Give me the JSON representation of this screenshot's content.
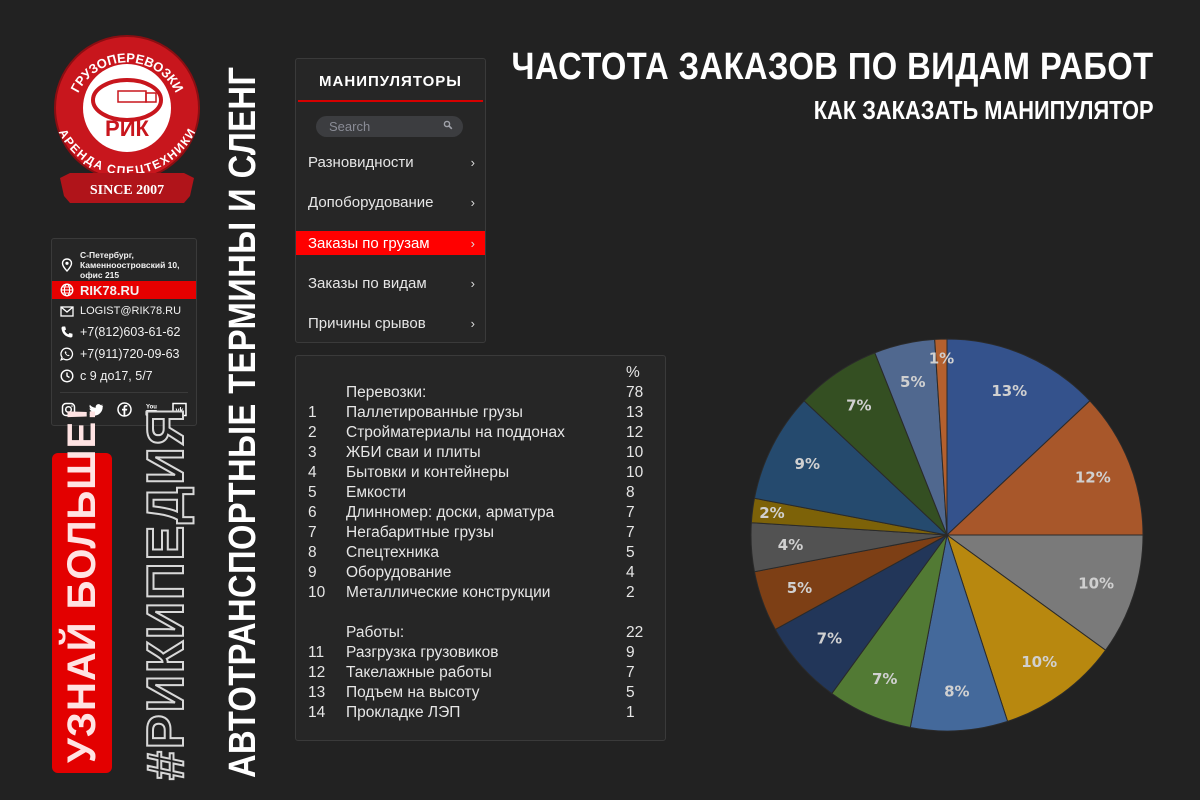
{
  "logo": {
    "top_text": "ГРУЗОПЕРЕВОЗКИ",
    "bottom_text": "АРЕНДА СПЕЦТЕХНИКИ",
    "brand": "РИК",
    "ribbon": "SINCE 2007",
    "color": "#d71920"
  },
  "contacts": {
    "address_line1": "С-Петербург,",
    "address_line2": "Каменноостровский 10,",
    "address_line3": "офис 215",
    "website": "RIK78.RU",
    "email": "LOGIST@RIK78.RU",
    "phone1": "+7(812)603-61-62",
    "phone2": "+7(911)720-09-63",
    "hours": "с 9 до17,  5/7",
    "socials": [
      "instagram",
      "twitter",
      "facebook",
      "youtube",
      "vk"
    ]
  },
  "sidebar": {
    "learn_more": "УЗНАЙ БОЛЬШЕ!",
    "hashtag": "#РИКИПЕДИЯ",
    "vertical_title": "АВТОТРАНСПОРТНЫЕ ТЕРМИНЫ И СЛЕНГ"
  },
  "menu": {
    "title": "МАНИПУЛЯТОРЫ",
    "search_placeholder": "Search",
    "items": [
      {
        "label": "Разновидности",
        "active": false
      },
      {
        "label": "Допоборудование",
        "active": false
      },
      {
        "label": "Заказы по грузам",
        "active": true
      },
      {
        "label": "Заказы по видам",
        "active": false
      },
      {
        "label": "Причины срывов",
        "active": false
      }
    ],
    "chevron": "›",
    "accent": "#ff0000"
  },
  "table": {
    "header_value": "%",
    "rows": [
      {
        "num": "",
        "label": "Перевозки:",
        "value": "78"
      },
      {
        "num": "1",
        "label": "Паллетированные грузы",
        "value": "13"
      },
      {
        "num": "2",
        "label": "Стройматериалы на поддонах",
        "value": "12"
      },
      {
        "num": "3",
        "label": "ЖБИ сваи и плиты",
        "value": "10"
      },
      {
        "num": "4",
        "label": "Бытовки и контейнеры",
        "value": "10"
      },
      {
        "num": "5",
        "label": "Емкости",
        "value": "8"
      },
      {
        "num": "6",
        "label": "Длинномер: доски, арматура",
        "value": "7"
      },
      {
        "num": "7",
        "label": "Негабаритные грузы",
        "value": "7"
      },
      {
        "num": "8",
        "label": "Спецтехника",
        "value": "5"
      },
      {
        "num": "9",
        "label": "Оборудование",
        "value": "4"
      },
      {
        "num": "10",
        "label": "Металлические конструкции",
        "value": "2"
      },
      {
        "num": "",
        "label": "",
        "value": ""
      },
      {
        "num": "",
        "label": "Работы:",
        "value": "22"
      },
      {
        "num": "11",
        "label": "Разгрузка грузовиков",
        "value": "9"
      },
      {
        "num": "12",
        "label": "Такелажные работы",
        "value": "7"
      },
      {
        "num": "13",
        "label": "Подъем на высоту",
        "value": "5"
      },
      {
        "num": "14",
        "label": "Прокладке ЛЭП",
        "value": "1"
      }
    ]
  },
  "header": {
    "title": "ЧАСТОТА ЗАКАЗОВ ПО ВИДАМ РАБОТ",
    "subtitle": "КАК ЗАКАЗАТЬ МАНИПУЛЯТОР"
  },
  "chart_data": {
    "type": "pie",
    "title": "ЧАСТОТА ЗАКАЗОВ ПО ВИДАМ РАБОТ",
    "start_angle": "12 o'clock",
    "direction": "clockwise",
    "legend": "none",
    "categories": [
      "Паллетированные грузы",
      "Стройматериалы на поддонах",
      "ЖБИ сваи и плиты",
      "Бытовки и контейнеры",
      "Емкости",
      "Длинномер: доски, арматура",
      "Негабаритные грузы",
      "Спецтехника",
      "Оборудование",
      "Металлические конструкции",
      "Разгрузка грузовиков",
      "Такелажные работы",
      "Подъем на высоту",
      "Прокладке ЛЭП"
    ],
    "values": [
      13,
      12,
      10,
      10,
      8,
      7,
      7,
      5,
      4,
      2,
      9,
      7,
      5,
      1
    ],
    "labels": [
      "13%",
      "12%",
      "10%",
      "10%",
      "8%",
      "7%",
      "7%",
      "5%",
      "4%",
      "2%",
      "9%",
      "7%",
      "5%",
      "1%"
    ],
    "colors": [
      "#34528c",
      "#a8572a",
      "#7a7a7a",
      "#b8880f",
      "#44699b",
      "#527a34",
      "#223659",
      "#7d3f15",
      "#525252",
      "#7d6208",
      "#254a6e",
      "#344f22",
      "#50688f",
      "#b4602e"
    ]
  }
}
